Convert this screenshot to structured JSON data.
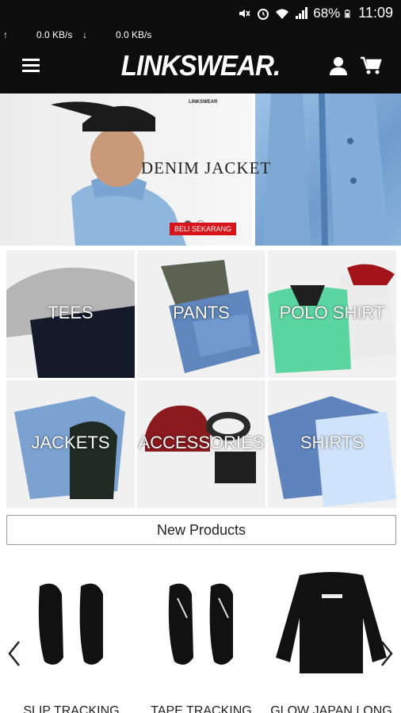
{
  "status": {
    "battery": "68%",
    "time": "11:09",
    "upload_speed": "0.0 KB/s",
    "download_speed": "0.0 KB/s"
  },
  "header": {
    "logo": "LINKSWEAR."
  },
  "hero": {
    "title": "DENIM JACKET",
    "cta": "BELI SEKARANG",
    "brandmark": "LINKSWEAR"
  },
  "categories": [
    {
      "label": "TEES"
    },
    {
      "label": "PANTS"
    },
    {
      "label": "POLO SHIRT"
    },
    {
      "label": "JACKETS"
    },
    {
      "label": "ACCESSORIES"
    },
    {
      "label": "SHIRTS"
    }
  ],
  "new_products": {
    "button_label": "New Products",
    "items": [
      {
        "name": "SLIP TRACKING SANDAL"
      },
      {
        "name": "TAPE TRACKING SANDAL"
      },
      {
        "name": "GLOW JAPAN LONG SLEEVE"
      }
    ]
  },
  "colors": {
    "header_bg": "#0d0d0d",
    "accent_red": "#d7141a"
  }
}
